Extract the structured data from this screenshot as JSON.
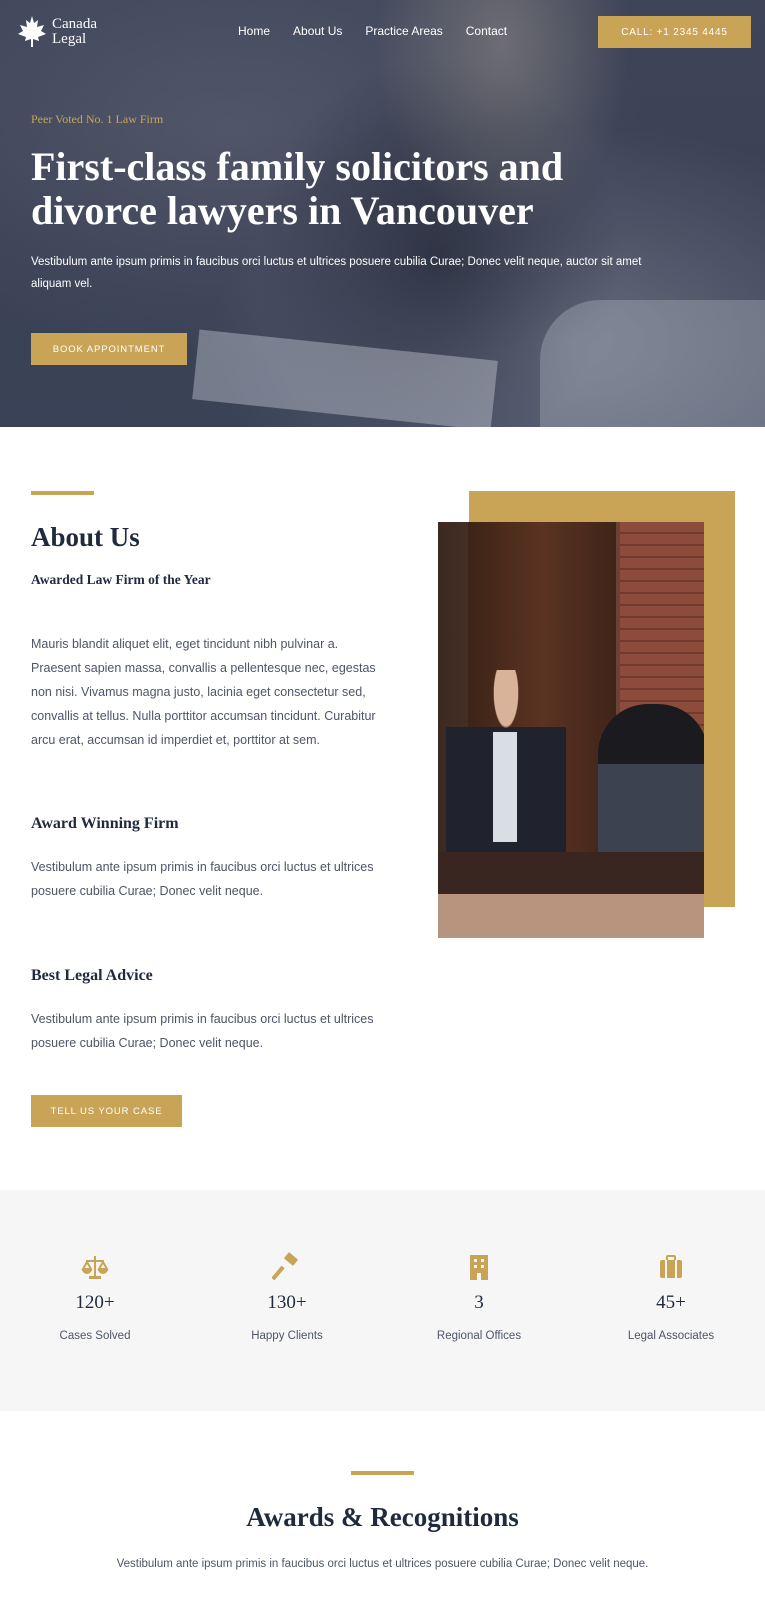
{
  "brand": {
    "name_line1": "Canada",
    "name_line2": "Legal"
  },
  "nav": {
    "links": [
      "Home",
      "About Us",
      "Practice Areas",
      "Contact"
    ],
    "call_label": "CALL: +1 2345 4445"
  },
  "hero": {
    "eyebrow": "Peer Voted No. 1 Law Firm",
    "title": "First-class family solicitors and divorce lawyers in Vancouver",
    "text": "Vestibulum ante ipsum primis in faucibus orci luctus et ultrices posuere cubilia Curae; Donec velit neque, auctor sit amet aliquam vel.",
    "button": "BOOK APPOINTMENT"
  },
  "about": {
    "title": "About Us",
    "subtitle": "Awarded Law Firm of the Year",
    "paragraph": "Mauris blandit aliquet elit, eget tincidunt nibh pulvinar a. Praesent sapien massa, convallis a pellentesque nec, egestas non nisi. Vivamus magna justo, lacinia eget consectetur sed, convallis at tellus. Nulla porttitor accumsan tincidunt. Curabitur arcu erat, accumsan id imperdiet et, porttitor at sem.",
    "award_heading": "Award Winning Firm",
    "award_text": "Vestibulum ante ipsum primis in faucibus orci luctus et ultrices posuere cubilia Curae; Donec velit neque.",
    "advice_heading": "Best Legal Advice",
    "advice_text": "Vestibulum ante ipsum primis in faucibus orci luctus et ultrices posuere cubilia Curae; Donec velit neque.",
    "button": "TELL US YOUR CASE"
  },
  "stats": [
    {
      "icon": "scales-icon",
      "value": "120+",
      "label": "Cases Solved"
    },
    {
      "icon": "gavel-icon",
      "value": "130+",
      "label": "Happy Clients"
    },
    {
      "icon": "building-icon",
      "value": "3",
      "label": "Regional Offices"
    },
    {
      "icon": "briefcase-icon",
      "value": "45+",
      "label": "Legal Associates"
    }
  ],
  "awards": {
    "title": "Awards & Recognitions",
    "text": "Vestibulum ante ipsum primis in faucibus orci luctus et ultrices posuere cubilia Curae; Donec velit neque."
  },
  "colors": {
    "accent": "#c9a457",
    "navy": "#1f2a3d",
    "hero_overlay": "#3b4255"
  }
}
